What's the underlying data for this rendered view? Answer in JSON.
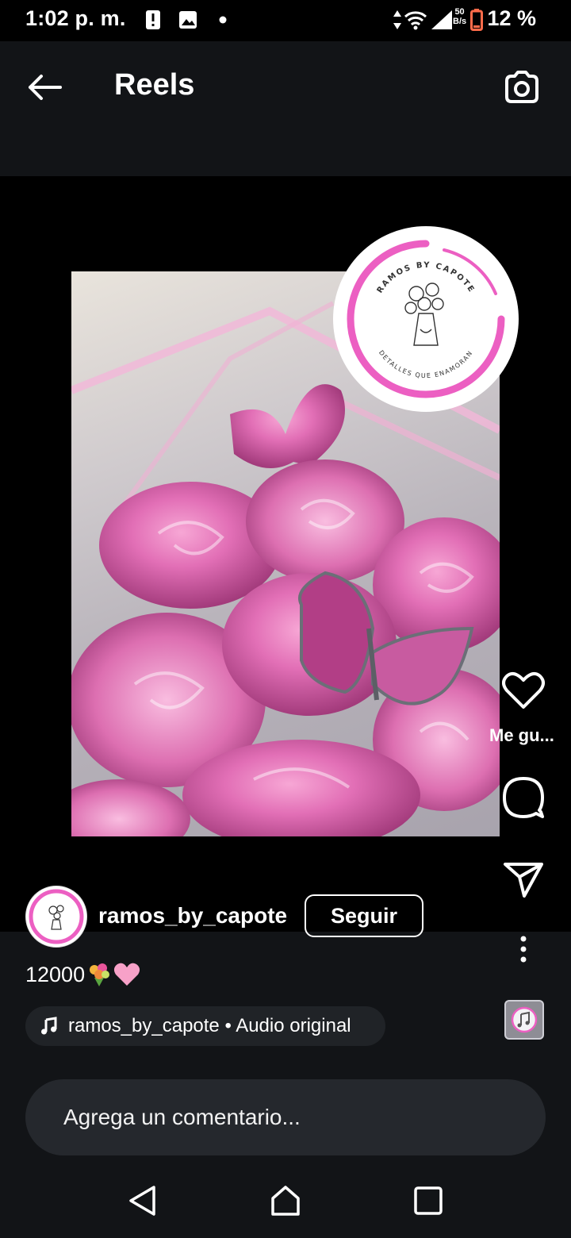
{
  "status_bar": {
    "time": "1:02 p. m.",
    "net_speed_value": "50",
    "net_speed_unit": "B/s",
    "battery_percent": "12 %",
    "battery_color": "#ff6b4a"
  },
  "header": {
    "title": "Reels",
    "back_icon": "arrow-left-icon",
    "camera_icon": "camera-icon"
  },
  "reel": {
    "logo_text_top": "RAMOS BY CAPOTE",
    "logo_text_bottom": "DETALLES QUE ENAMORAN",
    "like_label": "Me gu...",
    "accent": "#ec5fc2"
  },
  "author": {
    "username": "ramos_by_capote",
    "follow_label": "Seguir"
  },
  "caption": {
    "text": "12000"
  },
  "audio": {
    "label": "ramos_by_capote • Audio original"
  },
  "comment": {
    "placeholder": "Agrega un comentario..."
  },
  "nav": {
    "back_icon": "triangle-back-icon",
    "home_icon": "home-icon",
    "recents_icon": "square-recents-icon"
  }
}
